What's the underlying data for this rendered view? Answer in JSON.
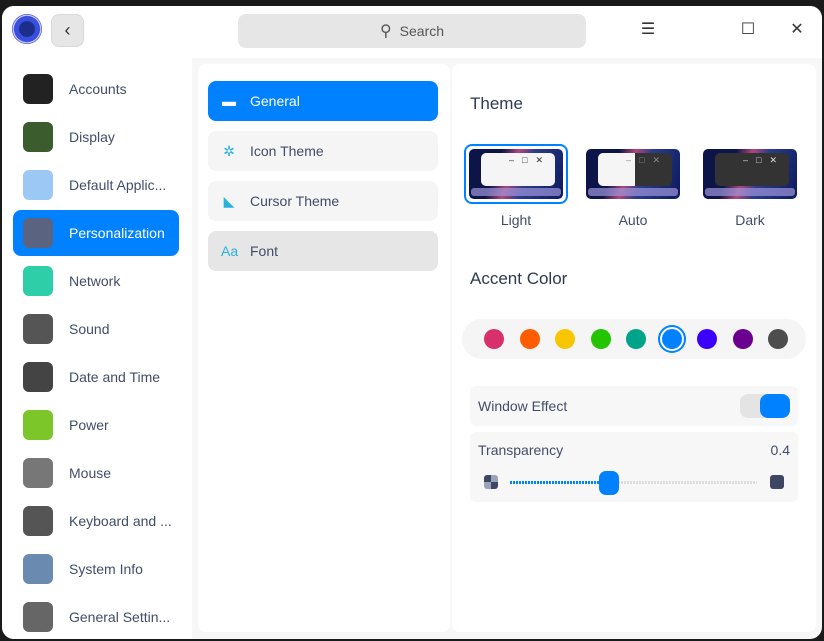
{
  "titlebar": {
    "search_placeholder": "Search",
    "back_icon": "chevron-left-icon",
    "menu_icon": "hamburger-icon",
    "maximize_icon": "maximize-icon",
    "close_icon": "close-icon"
  },
  "sidebar": {
    "items": [
      {
        "label": "Accounts",
        "icon": "accounts-icon",
        "color": "#222"
      },
      {
        "label": "Display",
        "icon": "display-icon",
        "color": "#3b5d2e"
      },
      {
        "label": "Default Applic...",
        "icon": "default-apps-icon",
        "color": "#9cc8f5"
      },
      {
        "label": "Personalization",
        "icon": "personalization-icon",
        "color": "#5a6480",
        "active": true
      },
      {
        "label": "Network",
        "icon": "network-icon",
        "color": "#2ecfa8"
      },
      {
        "label": "Sound",
        "icon": "sound-icon",
        "color": "#555"
      },
      {
        "label": "Date and Time",
        "icon": "clock-icon",
        "color": "#444"
      },
      {
        "label": "Power",
        "icon": "battery-icon",
        "color": "#7cc62a"
      },
      {
        "label": "Mouse",
        "icon": "mouse-icon",
        "color": "#777"
      },
      {
        "label": "Keyboard and ...",
        "icon": "keyboard-icon",
        "color": "#555"
      },
      {
        "label": "System Info",
        "icon": "system-info-icon",
        "color": "#6a8ab0"
      },
      {
        "label": "General Settin...",
        "icon": "gear-icon",
        "color": "#666"
      }
    ]
  },
  "middle": {
    "items": [
      {
        "label": "General",
        "icon": "window-icon",
        "glyph": "▬",
        "active": true
      },
      {
        "label": "Icon Theme",
        "icon": "flower-icon",
        "glyph": "✲"
      },
      {
        "label": "Cursor Theme",
        "icon": "cursor-icon",
        "glyph": "◣"
      },
      {
        "label": "Font",
        "icon": "font-icon",
        "glyph": "Aa",
        "hover": true
      }
    ]
  },
  "main": {
    "theme_title": "Theme",
    "themes": [
      {
        "label": "Light",
        "selected": true
      },
      {
        "label": "Auto"
      },
      {
        "label": "Dark"
      }
    ],
    "accent_title": "Accent Color",
    "accent_colors": [
      "#d8306b",
      "#ff5c00",
      "#f7c600",
      "#23c400",
      "#00a48a",
      "#0081ff",
      "#3c00ff",
      "#6b0090",
      "#4d4d4d"
    ],
    "accent_selected": "#0081ff",
    "window_effect": {
      "label": "Window Effect",
      "enabled": true
    },
    "transparency": {
      "label": "Transparency",
      "value": "0.4",
      "fraction": 0.4
    }
  }
}
